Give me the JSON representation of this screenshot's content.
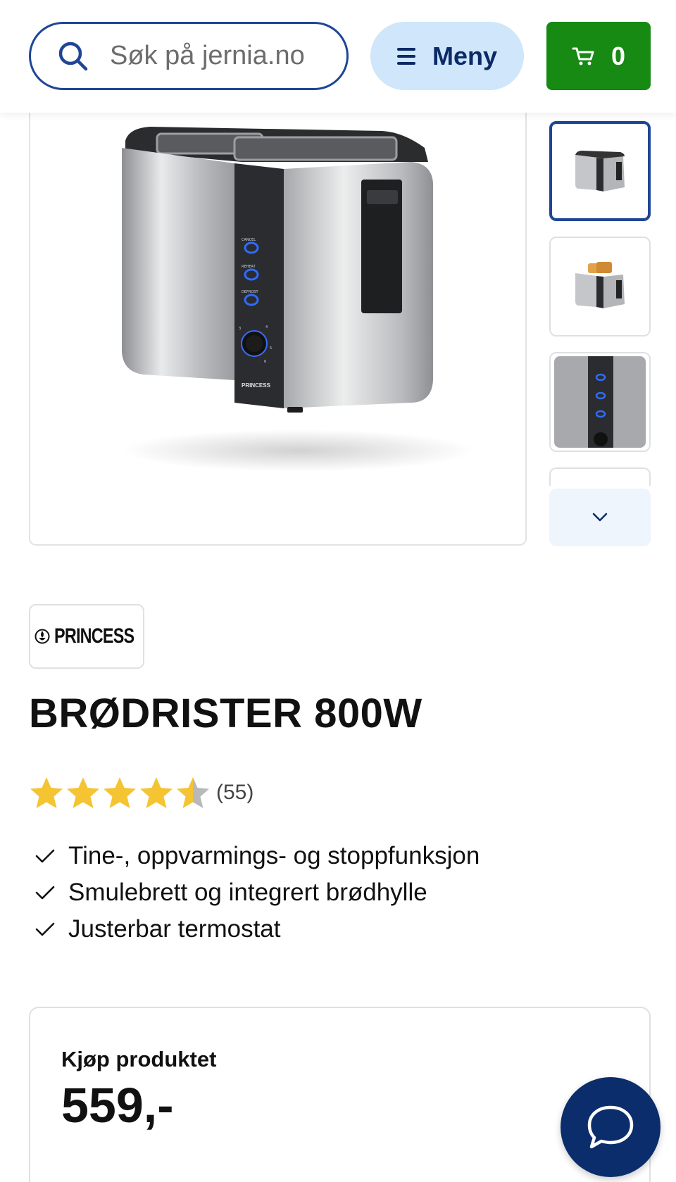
{
  "header": {
    "search_placeholder": "Søk på jernia.no",
    "menu_label": "Meny",
    "cart_count": "0"
  },
  "gallery": {
    "thumbnail_count_visible": 3,
    "active_thumbnail": 0,
    "toaster_panel_labels": [
      "CANCEL",
      "REHEAT",
      "DEFROST"
    ],
    "toaster_logo_text": "PRINCESS",
    "dial_marks": [
      "3",
      "4",
      "5",
      "6"
    ]
  },
  "product": {
    "brand": "PRINCESS",
    "title": "BRØDRISTER 800W",
    "rating_value": 4.5,
    "rating_max": 5,
    "rating_count": "(55)",
    "features": [
      "Tine-, oppvarmings- og stoppfunksjon",
      "Smulebrett og integrert brødhylle",
      "Justerbar termostat"
    ]
  },
  "buy": {
    "label": "Kjøp produktet",
    "price": "559,-"
  },
  "colors": {
    "brand_blue": "#1f4596",
    "menu_bg": "#cfe6fb",
    "cart_green": "#168a12",
    "chat_navy": "#0b2d6b",
    "star_gold": "#f5c433",
    "star_gray": "#b9b9b9"
  }
}
